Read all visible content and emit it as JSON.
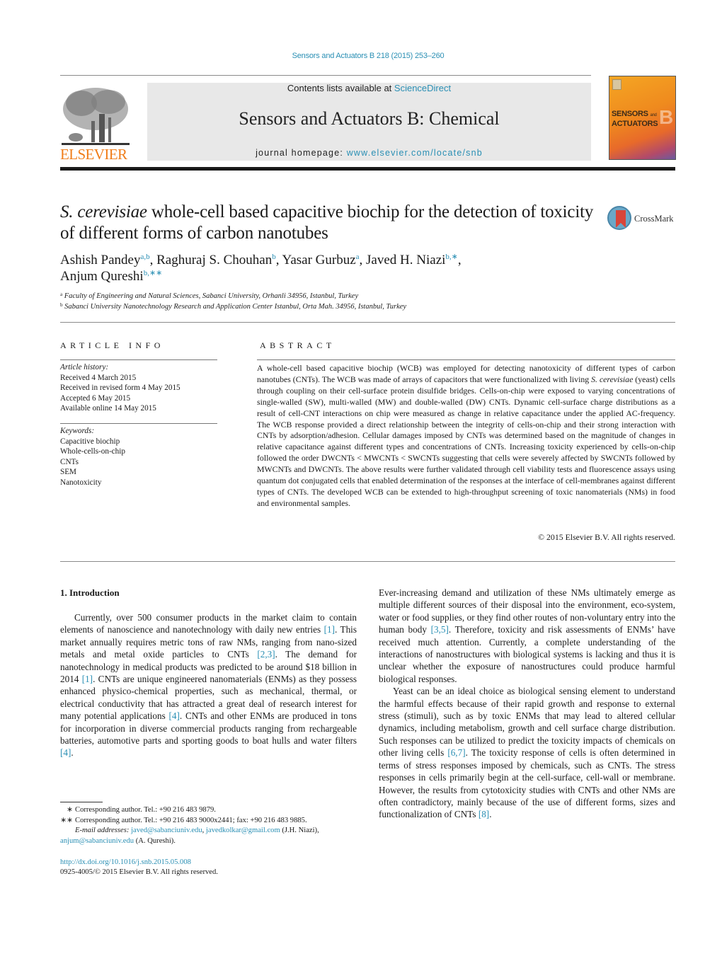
{
  "header": {
    "journal_reference": "Sensors and Actuators B 218 (2015) 253–260",
    "contents_prefix": "Contents lists available at ",
    "contents_link": "ScienceDirect",
    "journal_title": "Sensors and Actuators B: Chemical",
    "homepage_prefix": "journal homepage: ",
    "homepage_link": "www.elsevier.com/locate/snb",
    "publisher_logo_text": "ELSEVIER",
    "cover": {
      "title_line1": "SENSORS",
      "title_and": "and",
      "title_line2": "ACTUATORS",
      "letter": "B"
    },
    "colors": {
      "link": "#2a8fb4",
      "elsevier_orange": "#f07d19",
      "masthead_bg": "#e8e8e8"
    }
  },
  "article": {
    "title_italic": "S. cerevisiae",
    "title_rest": " whole-cell based capacitive biochip for the detection of toxicity of different forms of carbon nanotubes",
    "crossmark_label": "CrossMark",
    "authors": [
      {
        "name": "Ashish Pandey",
        "sup": "a,b",
        "sep": ", "
      },
      {
        "name": "Raghuraj S. Chouhan",
        "sup": "b",
        "sep": ", "
      },
      {
        "name": "Yasar Gurbuz",
        "sup": "a",
        "sep": ", "
      },
      {
        "name": "Javed H. Niazi",
        "sup": "b,∗",
        "sep": ","
      },
      {
        "name": "Anjum Qureshi",
        "sup": "b,∗∗",
        "sep": ""
      }
    ],
    "affiliations": [
      {
        "key": "a",
        "text": "Faculty of Engineering and Natural Sciences, Sabanci University, Orhanli 34956, Istanbul, Turkey"
      },
      {
        "key": "b",
        "text": "Sabanci University Nanotechnology Research and Application Center Istanbul, Orta Mah. 34956, Istanbul, Turkey"
      }
    ]
  },
  "article_info": {
    "heading": "ARTICLE INFO",
    "history_label": "Article history:",
    "history": [
      "Received 4 March 2015",
      "Received in revised form 4 May 2015",
      "Accepted 6 May 2015",
      "Available online 14 May 2015"
    ],
    "keywords_label": "Keywords:",
    "keywords": [
      "Capacitive biochip",
      "Whole-cells-on-chip",
      "CNTs",
      "SEM",
      "Nanotoxicity"
    ]
  },
  "abstract": {
    "heading": "ABSTRACT",
    "part1": "A whole-cell based capacitive biochip (WCB) was employed for detecting nanotoxicity of different types of carbon nanotubes (CNTs). The WCB was made of arrays of capacitors that were functionalized with living ",
    "italic1": "S. cerevisiae",
    "part2": " (yeast) cells through coupling on their cell-surface protein disulfide bridges. Cells-on-chip were exposed to varying concentrations of single-walled (SW), multi-walled (MW) and double-walled (DW) CNTs. Dynamic cell-surface charge distributions as a result of cell-CNT interactions on chip were measured as change in relative capacitance under the applied AC-frequency. The WCB response provided a direct relationship between the integrity of cells-on-chip and their strong interaction with CNTs by adsorption/adhesion. Cellular damages imposed by CNTs was determined based on the magnitude of changes in relative capacitance against different types and concentrations of CNTs. Increasing toxicity experienced by cells-on-chip followed the order DWCNTs < MWCNTs < SWCNTs suggesting that cells were severely affected by SWCNTs followed by MWCNTs and DWCNTs. The above results were further validated through cell viability tests and fluorescence assays using quantum dot conjugated cells that enabled determination of the responses at the interface of cell-membranes against different types of CNTs. The developed WCB can be extended to high-throughput screening of toxic nanomaterials (NMs) in food and environmental samples.",
    "copyright": "© 2015 Elsevier B.V. All rights reserved."
  },
  "introduction": {
    "heading": "1.  Introduction",
    "left_p1": [
      {
        "t": "Currently, over 500 consumer products in the market claim to contain elements of nanoscience and nanotechnology with daily new entries "
      },
      {
        "ref": "[1]"
      },
      {
        "t": ". This market annually requires metric tons of raw NMs, ranging from nano-sized metals and metal oxide particles to CNTs "
      },
      {
        "ref": "[2,3]"
      },
      {
        "t": ". The demand for nanotechnology in medical products was predicted to be around $18 billion in 2014 "
      },
      {
        "ref": "[1]"
      },
      {
        "t": ". CNTs are unique engineered nanomaterials (ENMs) as they possess enhanced physico-chemical properties, such as mechanical, thermal, or electrical conductivity that has attracted a great deal of research interest for many potential applications "
      },
      {
        "ref": "[4]"
      },
      {
        "t": ". CNTs and other ENMs are produced in tons for incorporation in diverse commercial products ranging from rechargeable batteries, automotive parts and sporting goods to boat hulls and water filters "
      },
      {
        "ref": "[4]"
      },
      {
        "t": "."
      }
    ],
    "right_p1": [
      {
        "t": "Ever-increasing demand and utilization of these NMs ultimately emerge as multiple different sources of their disposal into the environment, eco-system, water or food supplies, or they find other routes of non-voluntary entry into the human body "
      },
      {
        "ref": "[3,5]"
      },
      {
        "t": ". Therefore, toxicity and risk assessments of ENMs’ have received much attention. Currently, a complete understanding of the interactions of nanostructures with biological systems is lacking and thus it is unclear whether the exposure of nanostructures could produce harmful biological responses."
      }
    ],
    "right_p2": [
      {
        "t": "Yeast can be an ideal choice as biological sensing element to understand the harmful effects because of their rapid growth and response to external stress (stimuli), such as by toxic ENMs that may lead to altered cellular dynamics, including metabolism, growth and cell surface charge distribution. Such responses can be utilized to predict the toxicity impacts of chemicals on other living cells "
      },
      {
        "ref": "[6,7]"
      },
      {
        "t": ". The toxicity response of cells is often determined in terms of stress responses imposed by chemicals, such as CNTs. The stress responses in cells primarily begin at the cell-surface, cell-wall or membrane. However, the results from cytotoxicity studies with CNTs and other NMs are often contradictory, mainly because of the use of different forms, sizes and functionalization of CNTs "
      },
      {
        "ref": "[8]"
      },
      {
        "t": "."
      }
    ]
  },
  "footnotes": {
    "fn1_mark": "∗",
    "fn1_text": "Corresponding author. Tel.: +90 216 483 9879.",
    "fn2_mark": "∗∗",
    "fn2_text": "Corresponding author. Tel.: +90 216 483 9000x2441; fax: +90 216 483 9885.",
    "email_label": "E-mail addresses: ",
    "email1": "javed@sabanciuniv.edu",
    "email_sep": ", ",
    "email2": "javedkolkar@gmail.com",
    "email12_owner": " (J.H. Niazi),",
    "email3": "anjum@sabanciuniv.edu",
    "email3_owner": " (A. Qureshi).",
    "doi": "http://dx.doi.org/10.1016/j.snb.2015.05.008",
    "issn": "0925-4005/© 2015 Elsevier B.V. All rights reserved."
  }
}
